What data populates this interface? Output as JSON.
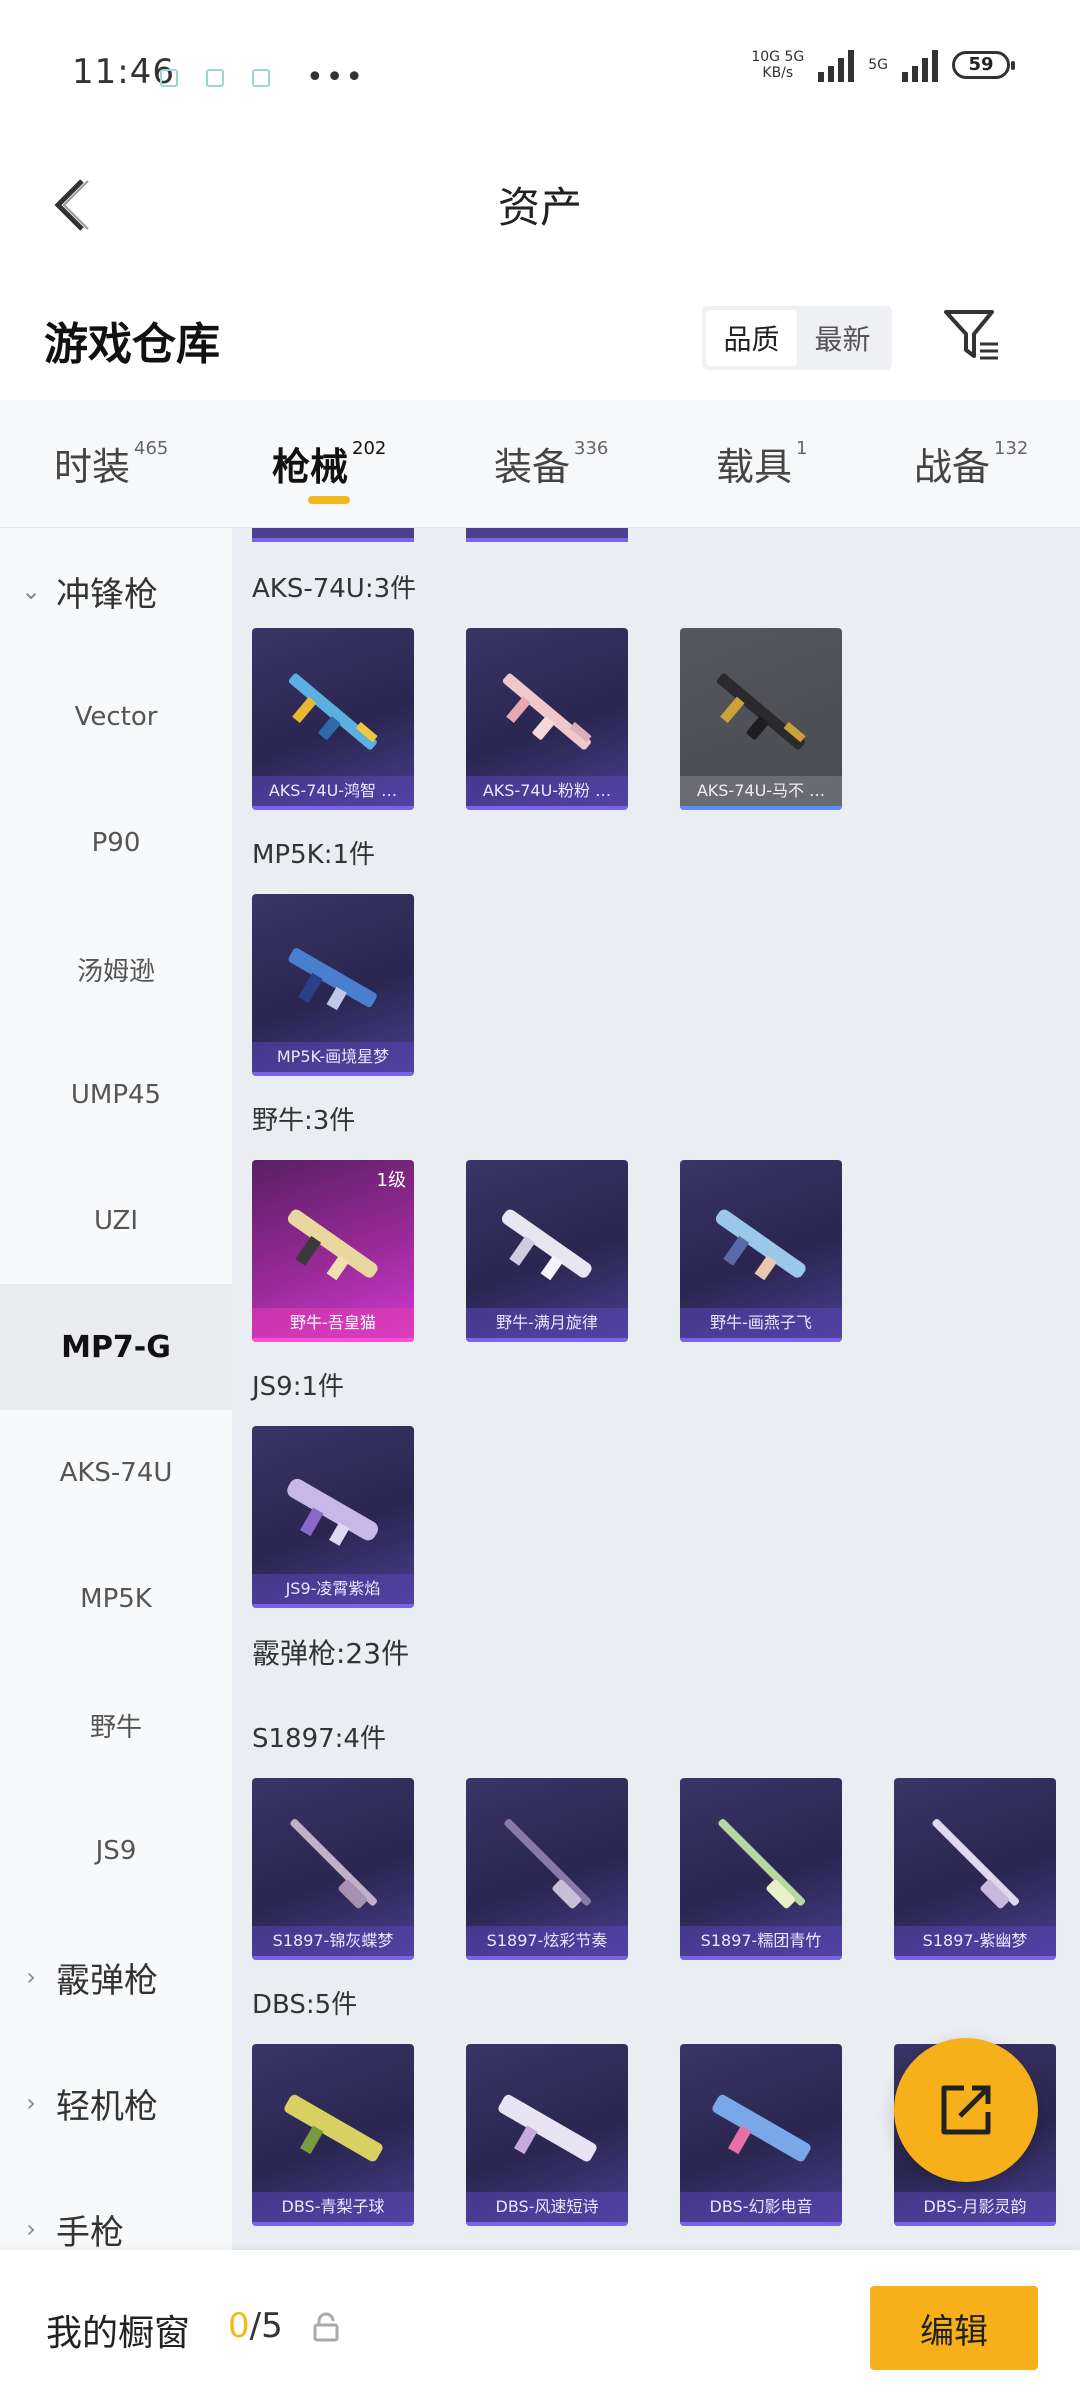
{
  "status_bar": {
    "time": "11:46",
    "net_speed_top": "10G 5G",
    "net_speed_bottom": "KB/s",
    "net_type2": "5G",
    "battery": "59"
  },
  "header": {
    "title": "资产"
  },
  "warehouse": {
    "title": "游戏仓库",
    "sort_options": [
      "品质",
      "最新"
    ],
    "sort_selected": "品质"
  },
  "tabs": [
    {
      "label": "时装",
      "count": "465"
    },
    {
      "label": "枪械",
      "count": "202"
    },
    {
      "label": "装备",
      "count": "336"
    },
    {
      "label": "载具",
      "count": "1"
    },
    {
      "label": "战备",
      "count": "132"
    }
  ],
  "sidebar": {
    "group_smg": "冲锋枪",
    "items": [
      "Vector",
      "P90",
      "汤姆逊",
      "UMP45",
      "UZI",
      "MP7-G",
      "AKS-74U",
      "MP5K",
      "野牛",
      "JS9"
    ],
    "selected": "MP7-G",
    "group_shotgun": "霰弹枪",
    "group_lmg": "轻机枪",
    "group_pistol": "手枪"
  },
  "groups": [
    {
      "label": "AKS-74U:3件",
      "items": [
        "AKS-74U-鸿智 …",
        "AKS-74U-粉粉 …",
        "AKS-74U-马不 …"
      ]
    },
    {
      "label": "MP5K:1件",
      "items": [
        "MP5K-画境星梦"
      ]
    },
    {
      "label": "野牛:3件",
      "items": [
        "野牛-吾皇猫",
        "野牛-满月旋律",
        "野牛-画燕子飞"
      ],
      "first_level": "1级"
    },
    {
      "label": "JS9:1件",
      "items": [
        "JS9-凌霄紫焰"
      ]
    },
    {
      "label": "霰弹枪:23件"
    },
    {
      "label": "S1897:4件",
      "items": [
        "S1897-锦灰蝶梦",
        "S1897-炫彩节奏",
        "S1897-糯团青竹",
        "S1897-紫幽梦"
      ]
    },
    {
      "label": "DBS:5件",
      "items": [
        "DBS-青梨子球",
        "DBS-风速短诗",
        "DBS-幻影电音",
        "DBS-月影灵韵"
      ]
    }
  ],
  "bottom_bar": {
    "showcase_label": "我的橱窗",
    "current": "0",
    "total": "/5",
    "edit_label": "编辑"
  },
  "colors": {
    "accent": "#f7b01a",
    "card_purple": "#2a2650",
    "card_pink": "#d23bd0",
    "card_gray": "#4a4b50"
  }
}
